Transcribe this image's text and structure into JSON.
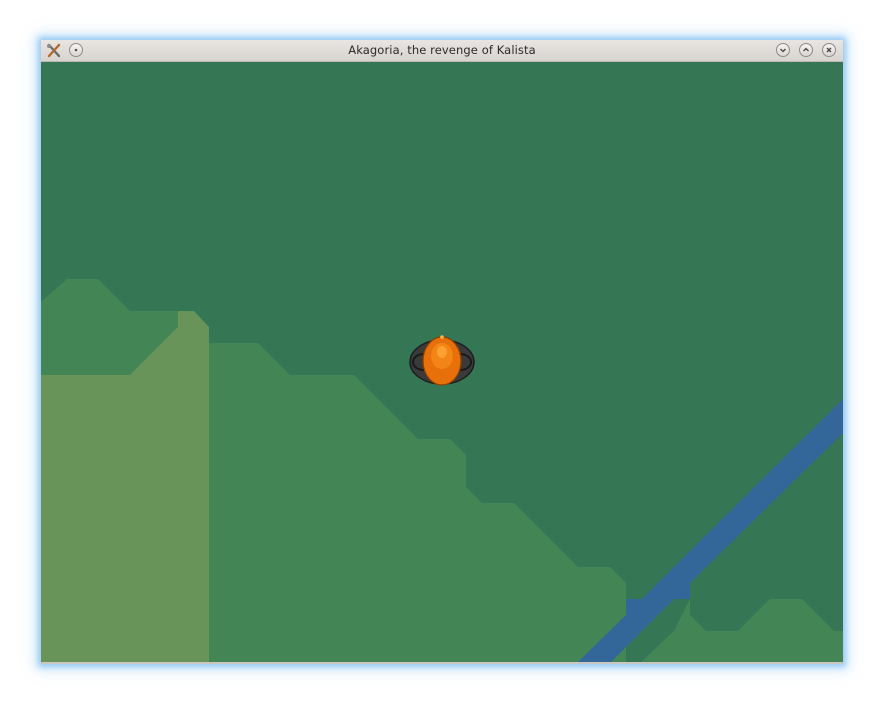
{
  "window": {
    "title": "Akagoria, the revenge of Kalista",
    "app_icon": "tools-icon",
    "menu_button_icon": "window-menu-dot-icon",
    "minimize_icon": "chevron-down-icon",
    "maximize_icon": "chevron-up-icon",
    "close_icon": "close-x-icon"
  },
  "game": {
    "player_icon": "orange-shelled-creature-icon",
    "terrain": {
      "forest_color": "#357754",
      "grass_color": "#448555",
      "meadow_color": "#68945a",
      "river_color": "#336699"
    }
  }
}
